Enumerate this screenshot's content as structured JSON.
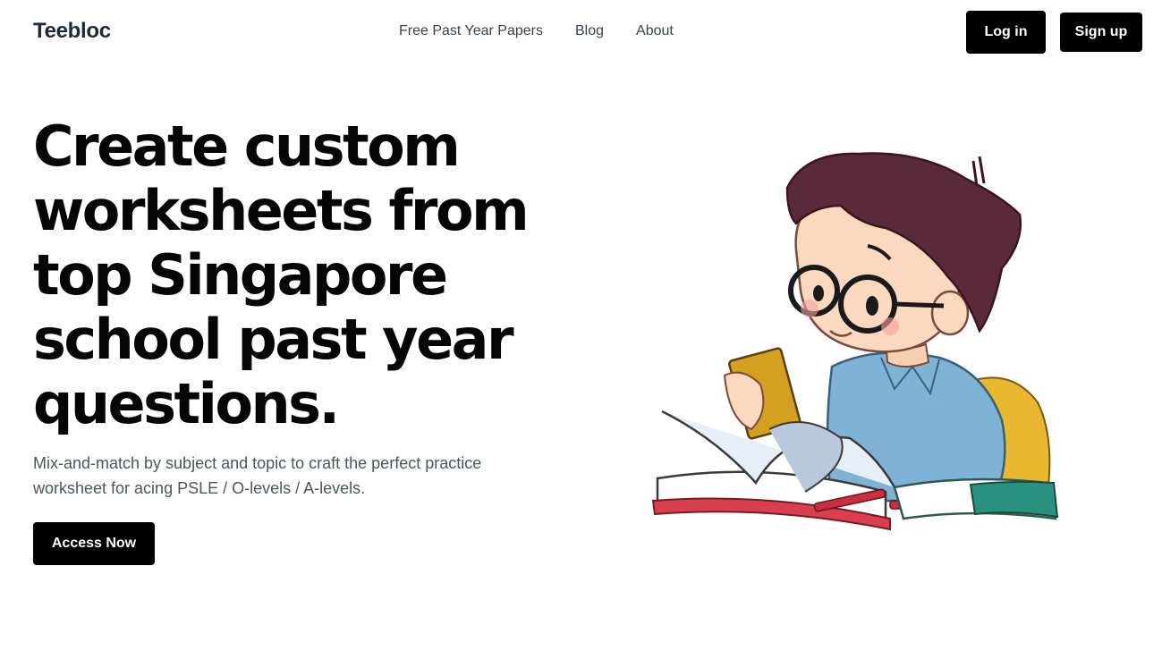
{
  "brand": {
    "name": "Teebloc"
  },
  "nav": {
    "links": [
      {
        "label": "Free Past Year Papers"
      },
      {
        "label": "Blog"
      },
      {
        "label": "About"
      }
    ],
    "login_label": "Log in",
    "signup_label": "Sign up"
  },
  "hero": {
    "headline": "Create custom worksheets from top Singapore school past year questions.",
    "subtext": "Mix-and-match by subject and topic to craft the perfect practice worksheet for acing PSLE / O-levels / A-levels.",
    "cta_label": "Access Now"
  },
  "colors": {
    "button_bg": "#000000",
    "button_text": "#ffffff",
    "heading": "#050505",
    "body_text": "#4b5563"
  },
  "icons": {
    "illustration": "boy-reading-book-illustration"
  }
}
